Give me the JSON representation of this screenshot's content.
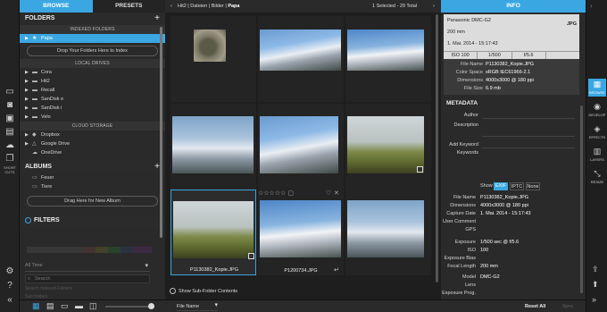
{
  "tabs": {
    "browse": "BROWSE",
    "presets": "PRESETS",
    "info": "INFO"
  },
  "folders": {
    "title": "FOLDERS",
    "indexed_header": "INDEXED FOLDERS",
    "indexed_items": [
      "Papa"
    ],
    "drop_index": "Drop Your Folders Here to Index",
    "local_header": "LOCAL DRIVES",
    "local_items": [
      "Cora",
      "Hit2",
      "Recall",
      "SanDisk e",
      "SanDisk i",
      "Velo"
    ],
    "cloud_header": "CLOUD STORAGE",
    "cloud_items": [
      "Dropbox",
      "Google Drive",
      "OneDrive"
    ]
  },
  "albums": {
    "title": "ALBUMS",
    "items": [
      "Feuer",
      "Tiere"
    ],
    "drop_new": "Drag Here for New Album"
  },
  "filters": {
    "title": "FILTERS",
    "time": "All Time",
    "search_placeholder": "Search",
    "option": "Search Indexed Folders",
    "sub": "Sub folders"
  },
  "left_rail": {
    "shortcuts": "SHORT CUTS"
  },
  "breadcrumb": {
    "path": [
      "Hit2",
      "Dateien",
      "Bilder",
      "Papa"
    ],
    "status": "1 Selected - 29 Total"
  },
  "grid": {
    "items": [
      {
        "name": "",
        "kind": "arch"
      },
      {
        "name": "",
        "kind": "mtn1"
      },
      {
        "name": "",
        "kind": "mtn2"
      },
      {
        "name": "",
        "kind": "mtn3"
      },
      {
        "name": "",
        "kind": "mtn1"
      },
      {
        "name": "",
        "kind": "grass"
      },
      {
        "name": "P1130382_Kopie.JPG",
        "kind": "grass"
      },
      {
        "name": "P1200734.JPG",
        "kind": "mtn2"
      },
      {
        "name": "",
        "kind": "mtn3"
      }
    ],
    "show_subfolders": "Show Sub-Folder Contents"
  },
  "info": {
    "camera": "Panasonic DMC-G2",
    "format": "JPG",
    "focal": "200 mm",
    "date": "1. Mai. 2014 - 15:17:43",
    "iso": "ISO 100",
    "shutter": "1/500",
    "fstop": "f/5.6",
    "file_name_label": "File Name",
    "file_name": "P1130382_Kopie.JPG",
    "color_space_label": "Color Space",
    "color_space": "sRGB IEC61966-2.1",
    "dimensions_label": "Dimensions",
    "dimensions": "4000x3000 @ 180 ppi",
    "file_size_label": "File Size",
    "file_size": "6.9 mb",
    "metadata_title": "METADATA",
    "author_label": "Author",
    "description_label": "Description",
    "add_keyword_label": "Add Keyword",
    "keywords_label": "Keywords",
    "show_label": "Show",
    "exif_tab": "EXIF",
    "iptc_tab": "IPTC",
    "none_tab": "None",
    "exif_rows": [
      {
        "label": "File Name",
        "value": "P1130382_Kopie.JPG"
      },
      {
        "label": "Dimensions",
        "value": "4000x3000 @ 180 ppi"
      },
      {
        "label": "Capture Date",
        "value": "1. Mai. 2014 - 15:17:43"
      },
      {
        "label": "User Comment",
        "value": ""
      },
      {
        "label": "GPS",
        "value": ""
      },
      {
        "label": "Exposure",
        "value": "1/500 sec @ f/5.6"
      },
      {
        "label": "ISO",
        "value": "100"
      },
      {
        "label": "Exposure Bias",
        "value": ""
      },
      {
        "label": "Focal Length",
        "value": "200 mm"
      },
      {
        "label": "Model",
        "value": "DMC-G2"
      },
      {
        "label": "Lens",
        "value": ""
      },
      {
        "label": "Exposure Prog.",
        "value": ""
      }
    ]
  },
  "right_rail": {
    "browse": "BROWSE",
    "develop": "DEVELOP",
    "effects": "EFFECTS",
    "layers": "LAYERS",
    "resize": "RESIZE"
  },
  "bottom": {
    "sort": "File Name",
    "reset_all": "Reset All",
    "sync": "Sync"
  },
  "colors": {
    "accent": "#3aa7e3"
  }
}
